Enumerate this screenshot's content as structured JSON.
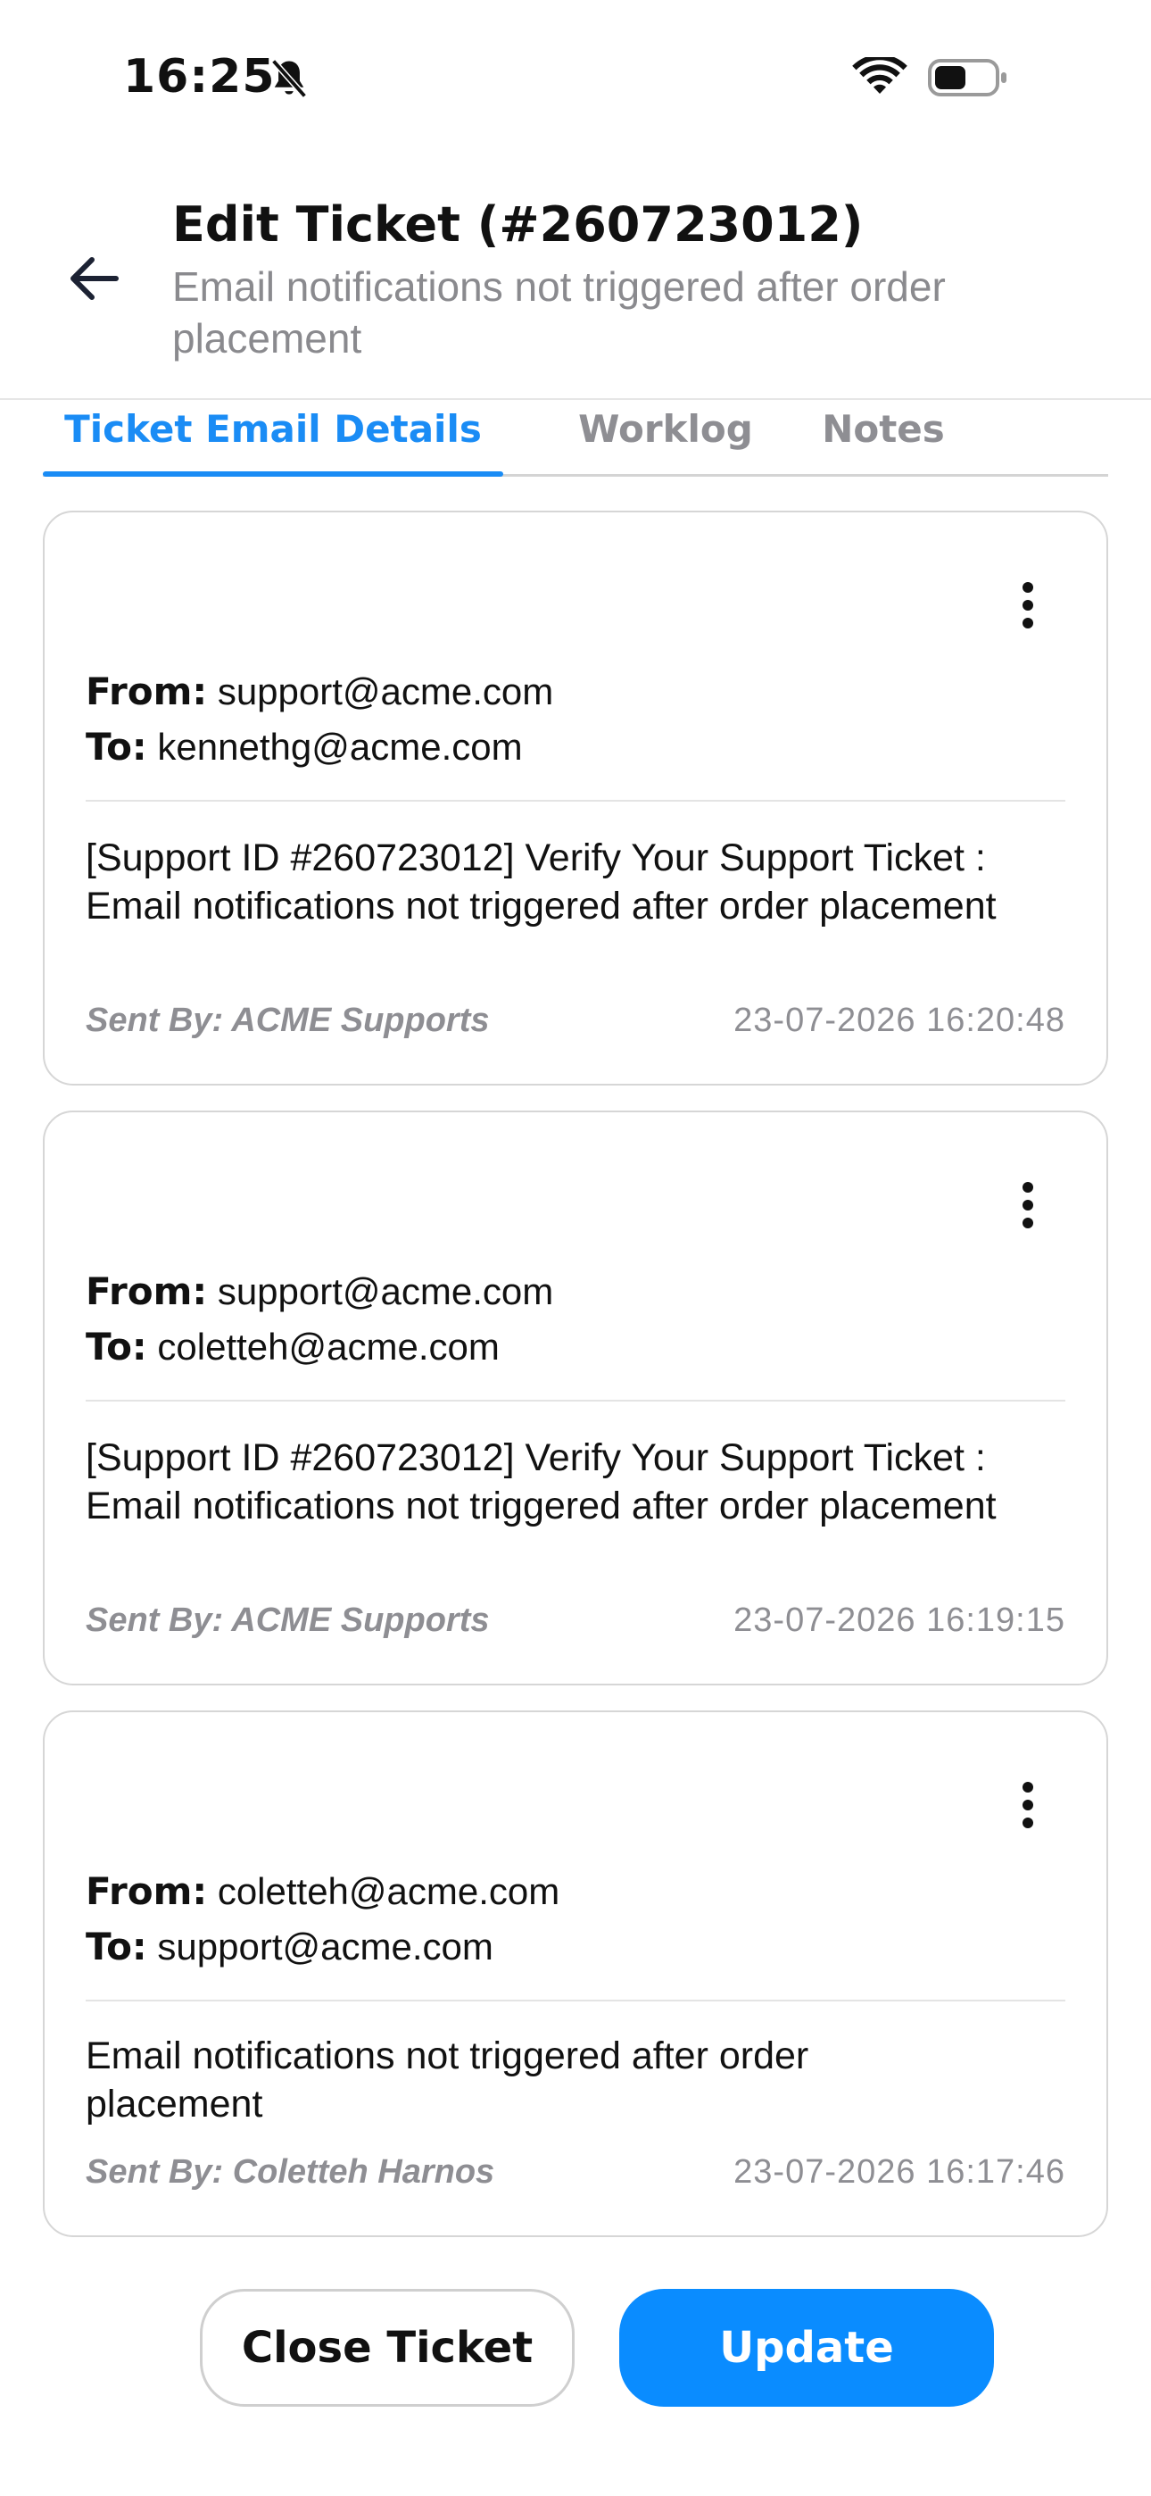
{
  "status_bar": {
    "time": "16:25",
    "icons": [
      "bell-slash-icon",
      "wifi-icon",
      "battery-icon"
    ]
  },
  "header": {
    "back_icon": "arrow-left-icon",
    "title": "Edit Ticket (#260723012)",
    "subtitle": "Email notifications not triggered after order placement"
  },
  "tabs": [
    {
      "label": "Ticket Email Details",
      "active": true
    },
    {
      "label": "Worklog",
      "active": false
    },
    {
      "label": "Notes",
      "active": false
    }
  ],
  "emails": [
    {
      "from_label": "From:",
      "from": "support@acme.com",
      "to_label": "To:",
      "to": "kennethg@acme.com",
      "subject": "[Support ID #260723012] Verify Your Support Ticket  : Email notifications not triggered after order placement",
      "sent_by": "Sent By: ACME Supports",
      "timestamp": "23-07-2026 16:20:48"
    },
    {
      "from_label": "From:",
      "from": "support@acme.com",
      "to_label": "To:",
      "to": "coletteh@acme.com",
      "subject": "[Support ID #260723012] Verify Your Support Ticket  : Email notifications not triggered after order placement",
      "sent_by": "Sent By: ACME Supports",
      "timestamp": "23-07-2026 16:19:15"
    },
    {
      "from_label": "From:",
      "from": "coletteh@acme.com",
      "to_label": "To:",
      "to": "support@acme.com",
      "subject": "Email notifications not triggered after order placement",
      "sent_by": "Sent By: Coletteh Harnos",
      "timestamp": "23-07-2026 16:17:46"
    }
  ],
  "actions": {
    "close_label": "Close Ticket",
    "update_label": "Update"
  },
  "colors": {
    "accent": "#1a8cf5",
    "button_primary": "#0a8cff",
    "muted_text": "#8e8e93"
  }
}
